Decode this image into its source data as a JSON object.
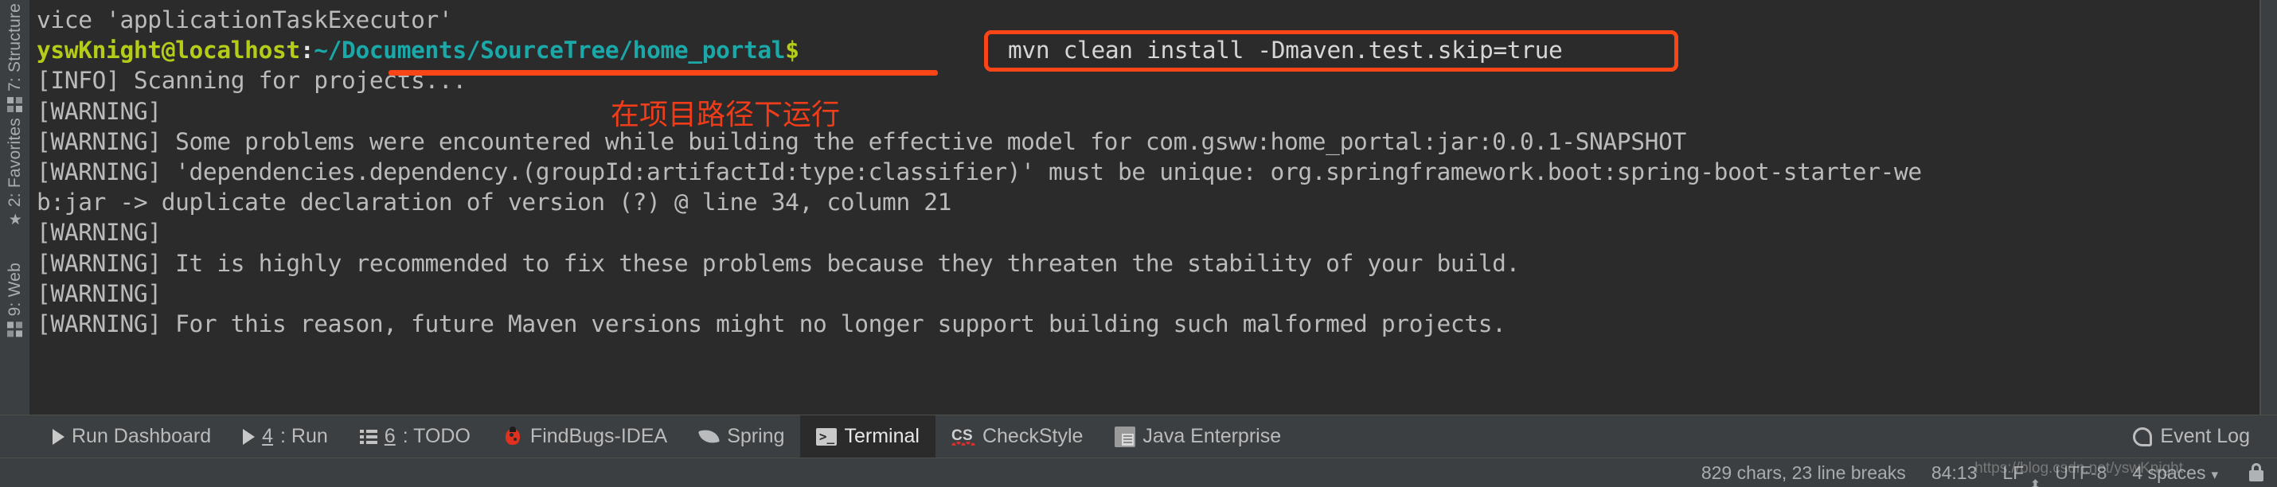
{
  "rail": {
    "items": [
      {
        "label": "7: Structure",
        "icon": "structure-icon"
      },
      {
        "label": "2: Favorites",
        "icon": "star-icon"
      },
      {
        "label": "9: Web",
        "icon": "web-icon"
      }
    ]
  },
  "terminal": {
    "prompt": {
      "user_host": "yswKnight@localhost",
      "separator": ":",
      "path": "~/Documents/SourceTree/home_portal",
      "sigil": "$"
    },
    "lines": [
      "vice 'applicationTaskExecutor'",
      "__PROMPT__",
      "[INFO] Scanning for projects...",
      "[WARNING]",
      "[WARNING] Some problems were encountered while building the effective model for com.gsww:home_portal:jar:0.0.1-SNAPSHOT",
      "[WARNING] 'dependencies.dependency.(groupId:artifactId:type:classifier)' must be unique: org.springframework.boot:spring-boot-starter-we",
      "b:jar -> duplicate declaration of version (?) @ line 34, column 21",
      "[WARNING]",
      "[WARNING] It is highly recommended to fix these problems because they threaten the stability of your build.",
      "[WARNING]",
      "[WARNING] For this reason, future Maven versions might no longer support building such malformed projects."
    ],
    "colors": {
      "background": "#2b2b2b",
      "foreground": "#bbbbbb",
      "user": "#b5cc18",
      "path": "#1aa8a8"
    }
  },
  "annotations": {
    "command_box_text": "mvn clean install -Dmaven.test.skip=true",
    "note_text": "在项目路径下运行",
    "color": "#fa4616"
  },
  "tool_window_bar": {
    "items": [
      {
        "label": "Run Dashboard",
        "mnemonic": "",
        "icon": "play-icon",
        "active": false
      },
      {
        "label": ": Run",
        "mnemonic": "4",
        "icon": "play-icon",
        "active": false
      },
      {
        "label": ": TODO",
        "mnemonic": "6",
        "icon": "todo-list-icon",
        "active": false
      },
      {
        "label": "FindBugs-IDEA",
        "mnemonic": "",
        "icon": "bug-icon",
        "active": false
      },
      {
        "label": "Spring",
        "mnemonic": "",
        "icon": "spring-leaf-icon",
        "active": false
      },
      {
        "label": "Terminal",
        "mnemonic": "",
        "icon": "terminal-icon",
        "active": true
      },
      {
        "label": "CheckStyle",
        "mnemonic": "",
        "icon": "checkstyle-icon",
        "active": false
      },
      {
        "label": "Java Enterprise",
        "mnemonic": "",
        "icon": "java-enterprise-icon",
        "active": false
      }
    ],
    "event_log": {
      "label": "Event Log",
      "icon": "event-log-icon"
    }
  },
  "status_bar": {
    "chars_info": "829 chars, 23 line breaks",
    "caret_position": "84:13",
    "line_separator": "LF",
    "encoding": "UTF-8",
    "indent": "4 spaces",
    "watermark": "https://blog.csdn.net/yswKnight"
  }
}
